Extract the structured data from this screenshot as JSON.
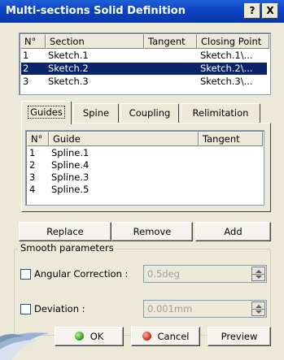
{
  "window": {
    "title": "Multi-sections Solid Definition",
    "help_label": "?",
    "close_label": "X"
  },
  "sections": {
    "columns": [
      "N°",
      "Section",
      "Tangent",
      "Closing Point"
    ],
    "rows": [
      {
        "n": "1",
        "section": "Sketch.1",
        "tangent": "",
        "closing": "Sketch.1\\..."
      },
      {
        "n": "2",
        "section": "Sketch.2",
        "tangent": "",
        "closing": "Sketch.2\\...",
        "selected": true
      },
      {
        "n": "3",
        "section": "Sketch.3",
        "tangent": "",
        "closing": "Sketch.3\\..."
      }
    ]
  },
  "tabs": [
    "Guides",
    "Spine",
    "Coupling",
    "Relimitation"
  ],
  "active_tab": "Guides",
  "guides": {
    "columns": [
      "N°",
      "Guide",
      "Tangent"
    ],
    "rows": [
      {
        "n": "1",
        "guide": "Spline.1"
      },
      {
        "n": "2",
        "guide": "Spline.4"
      },
      {
        "n": "3",
        "guide": "Spline.3"
      },
      {
        "n": "4",
        "guide": "Spline.5"
      }
    ]
  },
  "actions": {
    "replace": "Replace",
    "remove": "Remove",
    "add": "Add"
  },
  "smooth": {
    "legend": "Smooth parameters",
    "angular_label": "Angular Correction :",
    "angular_value": "0.5deg",
    "angular_checked": false,
    "deviation_label": "Deviation :",
    "deviation_value": "0.001mm",
    "deviation_checked": false
  },
  "footer": {
    "ok": "OK",
    "cancel": "Cancel",
    "preview": "Preview"
  },
  "colors": {
    "titlebar": "#0c43c4",
    "selection": "#0a246a",
    "ok_icon": "#1f9a14",
    "cancel_icon": "#c81f12"
  }
}
